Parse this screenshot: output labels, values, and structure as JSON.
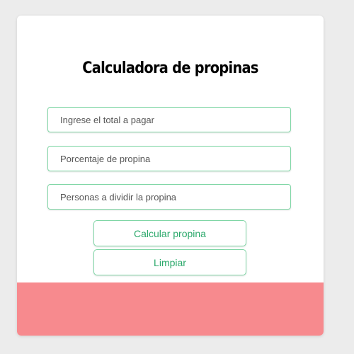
{
  "title": "Calculadora de propinas",
  "inputs": {
    "total_placeholder": "Ingrese el total a pagar",
    "percent_placeholder": "Porcentaje de propina",
    "people_placeholder": "Personas a dividir la propina"
  },
  "buttons": {
    "calculate_label": "Calcular propina",
    "clear_label": "Limpiar"
  },
  "colors": {
    "accent": "#2aa86a",
    "border": "#7fd6a5",
    "result_background": "#f78a8e",
    "page_background": "#ececec"
  }
}
